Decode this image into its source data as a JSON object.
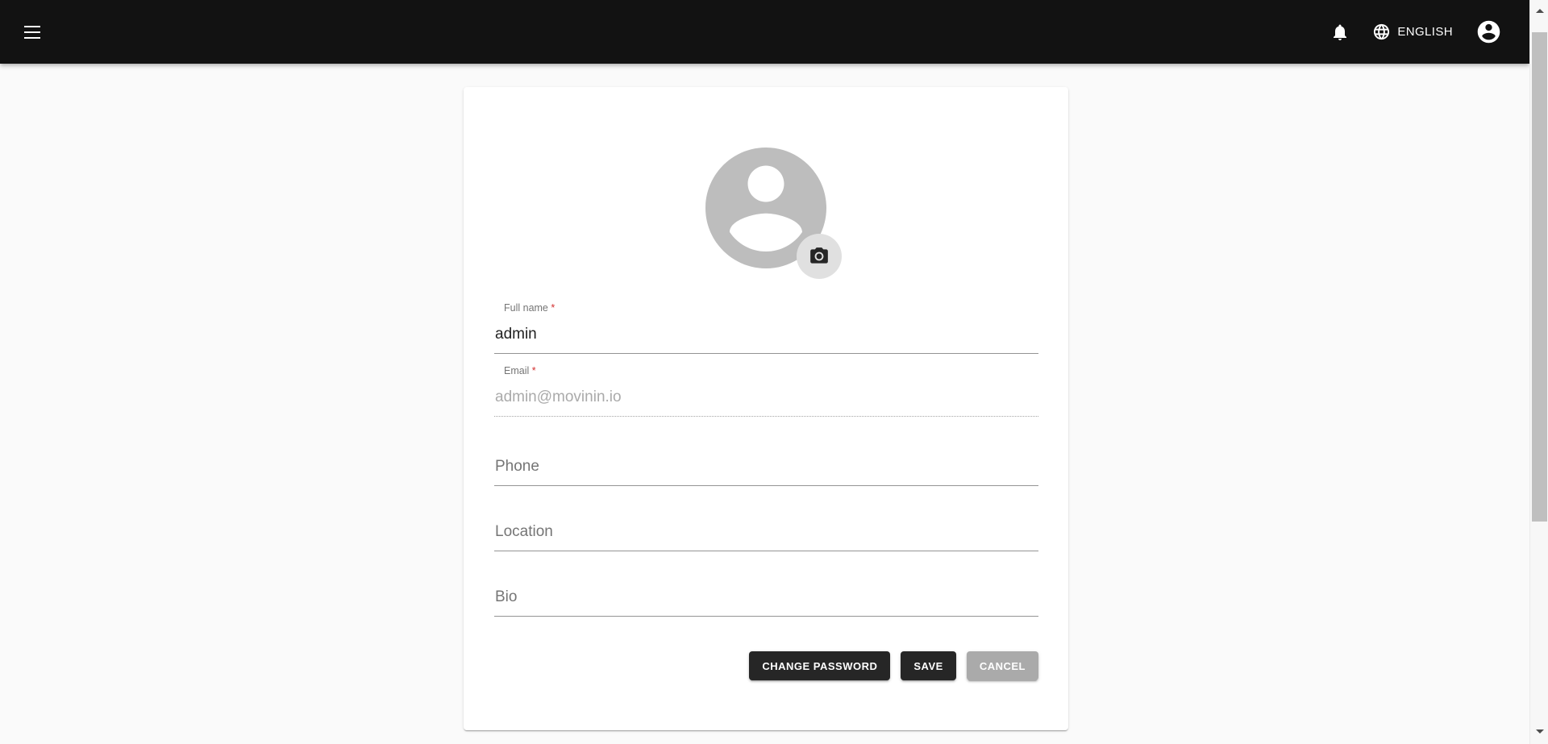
{
  "appbar": {
    "menu_icon": "hamburger-menu-icon",
    "notifications_icon": "bell-icon",
    "language_icon": "globe-icon",
    "language_label": "ENGLISH",
    "avatar_icon": "account-circle-icon",
    "background_color": "#121212"
  },
  "profile": {
    "avatar_placeholder_icon": "account-circle-placeholder-icon",
    "avatar_placeholder_color": "#bdbdbd",
    "camera_badge_icon": "camera-icon",
    "camera_badge_background": "#e0e0e0"
  },
  "form": {
    "fields": [
      {
        "name": "full-name",
        "label": "Full name",
        "required": true,
        "required_mark": "*",
        "value": "admin",
        "placeholder": "",
        "disabled": false
      },
      {
        "name": "email",
        "label": "Email",
        "required": true,
        "required_mark": "*",
        "value": "admin@movinin.io",
        "placeholder": "",
        "disabled": true
      },
      {
        "name": "phone",
        "label": "",
        "required": false,
        "required_mark": "",
        "value": "",
        "placeholder": "Phone",
        "disabled": false
      },
      {
        "name": "location",
        "label": "",
        "required": false,
        "required_mark": "",
        "value": "",
        "placeholder": "Location",
        "disabled": false
      },
      {
        "name": "bio",
        "label": "",
        "required": false,
        "required_mark": "",
        "value": "",
        "placeholder": "Bio",
        "disabled": false
      }
    ]
  },
  "actions": {
    "change_password_label": "CHANGE PASSWORD",
    "save_label": "SAVE",
    "cancel_label": "CANCEL",
    "primary_color": "#262626",
    "disabled_color": "#aaaaaa"
  },
  "scrollbar": {
    "up_arrow_icon": "triangle-up-icon",
    "down_arrow_icon": "triangle-down-icon",
    "thumb_color": "#bfbfbf"
  }
}
